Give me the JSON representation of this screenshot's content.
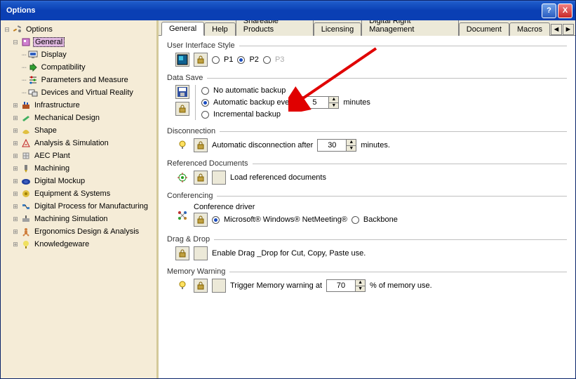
{
  "window": {
    "title": "Options"
  },
  "titlebar": {
    "help": "?",
    "close": "X"
  },
  "tree": {
    "root": "Options",
    "items": [
      {
        "label": "General",
        "selected": true
      },
      {
        "label": "Display"
      },
      {
        "label": "Compatibility"
      },
      {
        "label": "Parameters and Measure"
      },
      {
        "label": "Devices and Virtual Reality"
      }
    ],
    "cats": [
      "Infrastructure",
      "Mechanical Design",
      "Shape",
      "Analysis & Simulation",
      "AEC Plant",
      "Machining",
      "Digital Mockup",
      "Equipment & Systems",
      "Digital Process for Manufacturing",
      "Machining Simulation",
      "Ergonomics Design & Analysis",
      "Knowledgeware"
    ]
  },
  "tabs": {
    "items": [
      "General",
      "Help",
      "Shareable Products",
      "Licensing",
      "Digital Right Management",
      "Document",
      "Macros"
    ],
    "active": 0,
    "nav": {
      "prev": "◄",
      "next": "►"
    }
  },
  "uiStyle": {
    "title": "User Interface Style",
    "p1": "P1",
    "p2": "P2",
    "p3": "P3"
  },
  "dataSave": {
    "title": "Data Save",
    "noBackup": "No automatic backup",
    "autoBackup": "Automatic backup every",
    "autoVal": "5",
    "autoUnit": "minutes",
    "incremental": "Incremental backup"
  },
  "disconnect": {
    "title": "Disconnection",
    "label": "Automatic disconnection after",
    "val": "30",
    "unit": "minutes."
  },
  "refDocs": {
    "title": "Referenced Documents",
    "label": "Load referenced documents"
  },
  "conf": {
    "title": "Conferencing",
    "driver": "Conference driver",
    "ms": "Microsoft® Windows® NetMeeting®",
    "bb": "Backbone"
  },
  "dragDrop": {
    "title": "Drag & Drop",
    "label": "Enable Drag _Drop for Cut, Copy, Paste use."
  },
  "memWarn": {
    "title": "Memory Warning",
    "label": "Trigger Memory warning at",
    "val": "70",
    "unit": "% of memory use."
  }
}
